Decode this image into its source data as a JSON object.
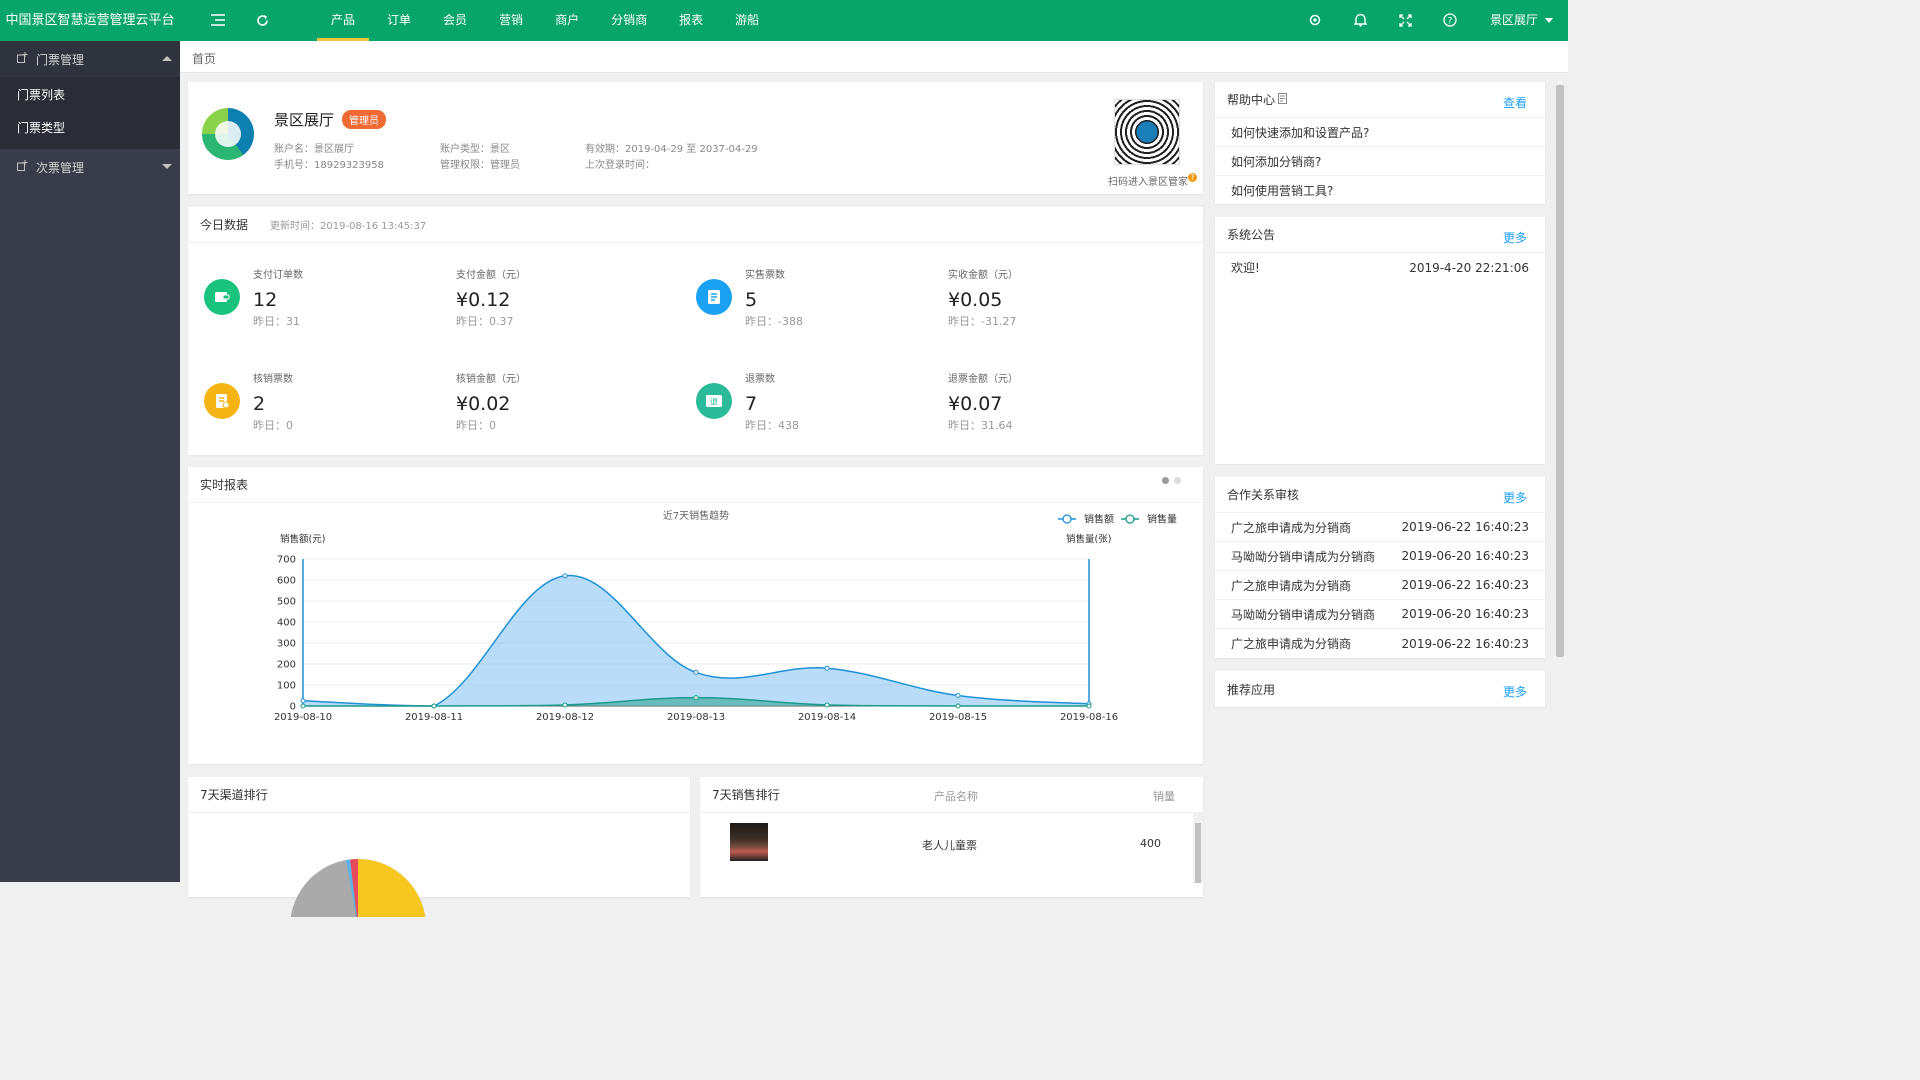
{
  "app_title": "中国景区智慧运营管理云平台",
  "nav": [
    "产品",
    "订单",
    "会员",
    "营销",
    "商户",
    "分销商",
    "报表",
    "游船"
  ],
  "nav_active": 0,
  "user_name": "景区展厅",
  "icons": {
    "menu": "menu-fold-icon",
    "refresh": "refresh-icon",
    "settings": "gear-icon",
    "bell": "bell-icon",
    "fullscreen": "fullscreen-icon",
    "help": "help-icon",
    "user_caret": "chevron-down-icon"
  },
  "colors": {
    "brand": "#07a56a",
    "nav_active_underline": "#f6c43d",
    "sidebar": "#393d49",
    "link": "#1e9fff",
    "badge": "#f06a35"
  },
  "sidebar": {
    "group1": "门票管理",
    "group1_items": [
      "门票列表",
      "门票类型"
    ],
    "group2": "次票管理"
  },
  "breadcrumb": "首页",
  "profile": {
    "name": "景区展厅",
    "role_badge": "管理员",
    "account_name": "账户名：景区展厅",
    "phone": "手机号：18929323958",
    "account_type": "账户类型：景区",
    "permission": "管理权限：管理员",
    "validity": "有效期：2019-04-29 至 2037-04-29",
    "last_login": "上次登录时间：",
    "qr_caption": "扫码进入景区管家"
  },
  "today": {
    "title": "今日数据",
    "updated": "更新时间：2019-08-16 13:45:37",
    "stats": [
      {
        "label": "支付订单数",
        "value": "12",
        "yesterday": "昨日：31"
      },
      {
        "label": "支付金额（元）",
        "value": "¥0.12",
        "yesterday": "昨日：0.37"
      },
      {
        "label": "实售票数",
        "value": "5",
        "yesterday": "昨日：-388"
      },
      {
        "label": "实收金额（元）",
        "value": "¥0.05",
        "yesterday": "昨日：-31.27"
      },
      {
        "label": "核销票数",
        "value": "2",
        "yesterday": "昨日：0"
      },
      {
        "label": "核销金额（元）",
        "value": "¥0.02",
        "yesterday": "昨日：0"
      },
      {
        "label": "退票数",
        "value": "7",
        "yesterday": "昨日：438"
      },
      {
        "label": "退票金额（元）",
        "value": "¥0.07",
        "yesterday": "昨日：31.64"
      }
    ],
    "icon_colors": [
      "#19c37d",
      "#1ba1f2",
      "#f5b314",
      "#2bbb9a"
    ],
    "icon_glyphs": [
      "▣",
      "⊞",
      "▤",
      "退"
    ]
  },
  "report": {
    "title": "实时报表"
  },
  "chart_data": {
    "type": "area",
    "title": "近7天销售趋势",
    "x": [
      "2019-08-10",
      "2019-08-11",
      "2019-08-12",
      "2019-08-13",
      "2019-08-14",
      "2019-08-15",
      "2019-08-16"
    ],
    "ylabel": "销售额(元)",
    "y2label": "销售量(张)",
    "ylim": [
      0,
      700
    ],
    "yticks": [
      0,
      100,
      200,
      300,
      400,
      500,
      600,
      700
    ],
    "legend_position": "top-right",
    "series": [
      {
        "name": "销售额",
        "values": [
          25,
          0,
          620,
          160,
          180,
          50,
          10
        ],
        "color": "#1e90d8"
      },
      {
        "name": "销售量",
        "values": [
          0,
          0,
          5,
          40,
          5,
          0,
          0
        ],
        "color": "#1a9a8a"
      }
    ]
  },
  "help": {
    "title": "帮助中心",
    "action": "查看",
    "items": [
      "如何快速添加和设置产品?",
      "如何添加分销商?",
      "如何使用营销工具?"
    ]
  },
  "notice": {
    "title": "系统公告",
    "action": "更多",
    "items": [
      {
        "text": "欢迎!",
        "time": "2019-4-20 22:21:06"
      }
    ]
  },
  "partner": {
    "title": "合作关系审核",
    "action": "更多",
    "items": [
      {
        "text": "广之旅申请成为分销商",
        "time": "2019-06-22 16:40:23"
      },
      {
        "text": "马呦呦分销申请成为分销商",
        "time": "2019-06-20 16:40:23"
      },
      {
        "text": "广之旅申请成为分销商",
        "time": "2019-06-22 16:40:23"
      },
      {
        "text": "马呦呦分销申请成为分销商",
        "time": "2019-06-20 16:40:23"
      },
      {
        "text": "广之旅申请成为分销商",
        "time": "2019-06-22 16:40:23"
      }
    ]
  },
  "recommend": {
    "title": "推荐应用",
    "action": "更多"
  },
  "channel_rank": {
    "title": "7天渠道排行"
  },
  "sales_rank": {
    "title": "7天销售排行",
    "col_product": "产品名称",
    "col_sales": "销量",
    "rows": [
      {
        "product": "老人儿童票",
        "sales": "400"
      }
    ]
  }
}
